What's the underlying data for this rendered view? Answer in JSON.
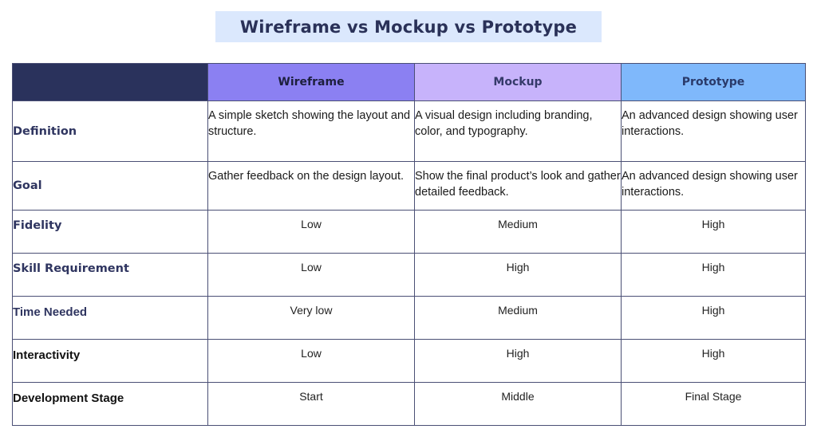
{
  "title": "Wireframe vs Mockup vs Prototype",
  "colors": {
    "title_bg": "#dbe8fd",
    "title_text": "#2a3158",
    "corner_header": "#2a325c",
    "wireframe_header": "#8b80f2",
    "mockup_header": "#c7b3fb",
    "prototype_header": "#7fb8fb",
    "border": "#4a4f75"
  },
  "table": {
    "columns": [
      "",
      "Wireframe",
      "Mockup",
      "Prototype"
    ],
    "rows": [
      {
        "label": "Definition",
        "wireframe": "A simple sketch showing the layout and structure.",
        "mockup": "A visual design including branding, color, and typography.",
        "prototype": "An advanced design showing user interactions."
      },
      {
        "label": "Goal",
        "wireframe": "Gather feedback on the design layout.",
        "mockup": "Show the final product’s look and gather detailed feedback.",
        "prototype": "An advanced design showing user interactions."
      },
      {
        "label": "Fidelity",
        "wireframe": "Low",
        "mockup": "Medium",
        "prototype": "High"
      },
      {
        "label": "Skill Requirement",
        "wireframe": "Low",
        "mockup": "High",
        "prototype": "High"
      },
      {
        "label": "Time Needed",
        "wireframe": "Very low",
        "mockup": "Medium",
        "prototype": "High"
      },
      {
        "label": "Interactivity",
        "wireframe": "Low",
        "mockup": "High",
        "prototype": "High"
      },
      {
        "label": "Development Stage",
        "wireframe": "Start",
        "mockup": "Middle",
        "prototype": "Final Stage"
      }
    ]
  }
}
